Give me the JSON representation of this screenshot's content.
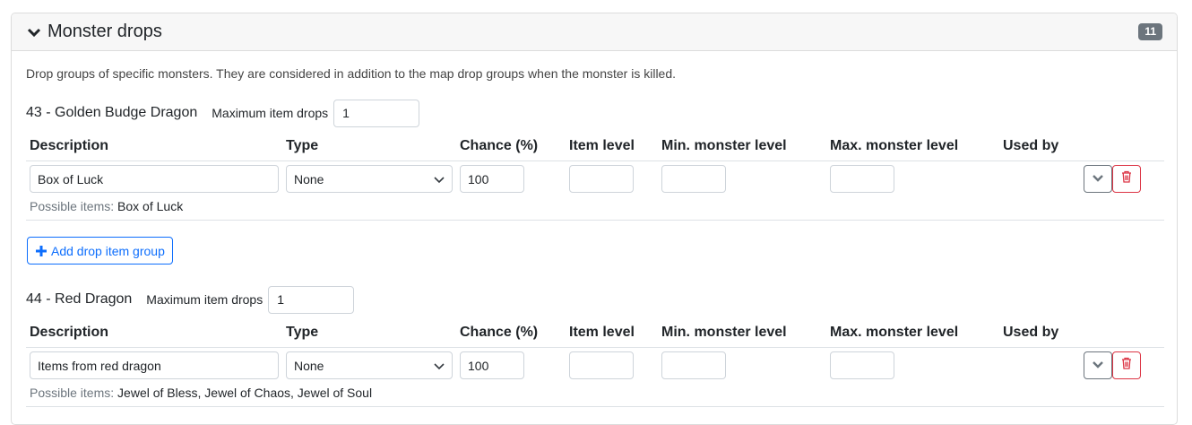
{
  "header": {
    "title": "Monster drops",
    "count": "11"
  },
  "description": "Drop groups of specific monsters. They are considered in addition to the map drop groups when the monster is killed.",
  "columns": [
    "Description",
    "Type",
    "Chance (%)",
    "Item level",
    "Min. monster level",
    "Max. monster level",
    "Used by"
  ],
  "labels": {
    "max_drops": "Maximum item drops",
    "possible_items": "Possible items:",
    "add_group": "Add drop item group"
  },
  "monsters": [
    {
      "name": "43 - Golden Budge Dragon",
      "max_drops": "1",
      "groups": [
        {
          "description": "Box of Luck",
          "type": "None",
          "chance": "100",
          "item_level": "",
          "min_level": "",
          "max_level": "",
          "possible_items": "Box of Luck"
        }
      ]
    },
    {
      "name": "44 - Red Dragon",
      "max_drops": "1",
      "groups": [
        {
          "description": "Items from red dragon",
          "type": "None",
          "chance": "100",
          "item_level": "",
          "min_level": "",
          "max_level": "",
          "possible_items": "Jewel of Bless, Jewel of Chaos, Jewel of Soul"
        }
      ]
    }
  ],
  "icons": {
    "collapse": "chevron-down-icon",
    "expand": "chevron-down-icon",
    "delete": "trash-icon",
    "add": "plus-icon"
  },
  "colors": {
    "primary": "#0d6efd",
    "danger": "#dc3545",
    "secondary": "#6c757d"
  }
}
